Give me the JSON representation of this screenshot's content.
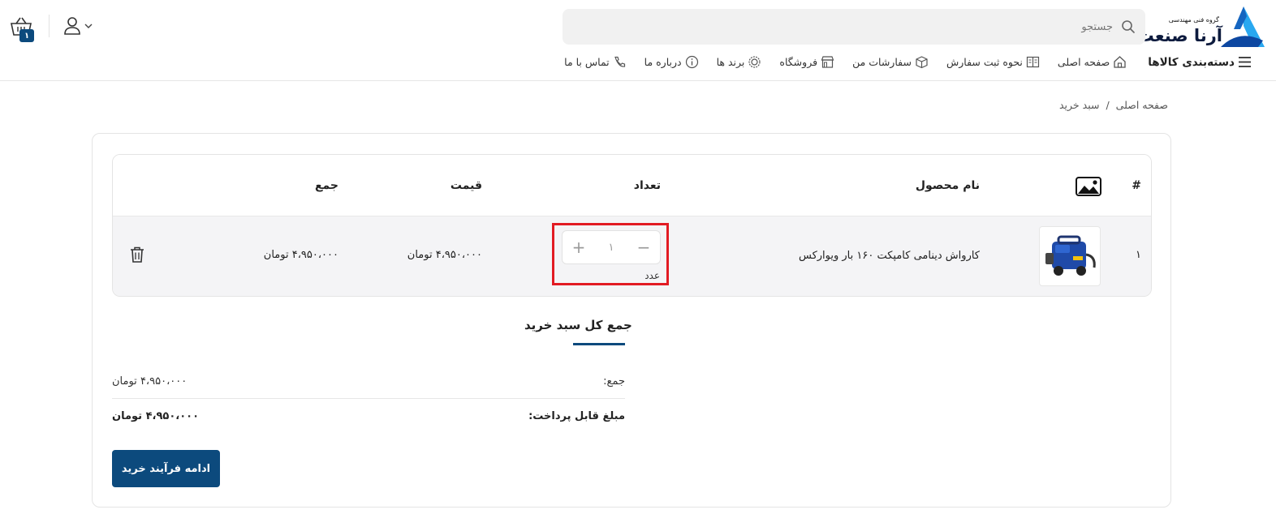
{
  "brand": {
    "tagline": "گروه فنی مهندسی",
    "name": "آرنا صنعت",
    "logo_color": "#1e88e5"
  },
  "search": {
    "placeholder": "جستجو"
  },
  "cart": {
    "count": "۱"
  },
  "nav": {
    "categories": "دسته‌بندی کالاها",
    "items": [
      {
        "label": "صفحه اصلی",
        "icon": "home-icon"
      },
      {
        "label": "نحوه ثبت سفارش",
        "icon": "book-icon"
      },
      {
        "label": "سفارشات من",
        "icon": "box-icon"
      },
      {
        "label": "فروشگاه",
        "icon": "store-icon"
      },
      {
        "label": "برند ها",
        "icon": "badge-icon"
      },
      {
        "label": "درباره ما",
        "icon": "info-icon"
      },
      {
        "label": "تماس با ما",
        "icon": "phone-icon"
      }
    ]
  },
  "breadcrumb": {
    "home": "صفحه اصلی",
    "separator": "/",
    "current": "سبد خرید"
  },
  "table": {
    "headers": {
      "index": "#",
      "image": "image-icon",
      "name": "نام محصول",
      "quantity": "تعداد",
      "price": "قیمت",
      "total": "جمع"
    },
    "rows": [
      {
        "index": "۱",
        "name": "کارواش دینامی کامپکت ۱۶۰ بار ویوارکس",
        "quantity": "۱",
        "unit": "عدد",
        "price": "۴،۹۵۰،۰۰۰ تومان",
        "total": "۴،۹۵۰،۰۰۰ تومان"
      }
    ]
  },
  "totals": {
    "title": "جمع کل سبد خرید",
    "subtotal_label": "جمع:",
    "subtotal_value": "۴،۹۵۰،۰۰۰ تومان",
    "payable_label": "مبلغ قابل پرداخت:",
    "payable_value": "۴،۹۵۰،۰۰۰ تومان"
  },
  "checkout": {
    "label": "ادامه فرآیند خرید"
  },
  "colors": {
    "primary": "#0c4a7d",
    "highlight": "#e21b23"
  }
}
